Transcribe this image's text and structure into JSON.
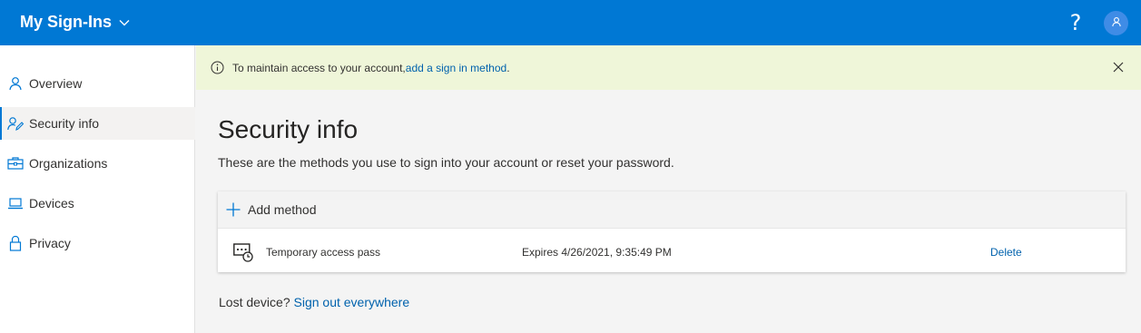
{
  "header": {
    "app_title": "My Sign-Ins",
    "help_label": "?",
    "colors": {
      "bar": "#0078d4",
      "avatar": "#3f8ce6"
    }
  },
  "sidebar": {
    "items": [
      {
        "label": "Overview",
        "icon": "person-icon",
        "active": false
      },
      {
        "label": "Security info",
        "icon": "person-edit-icon",
        "active": true
      },
      {
        "label": "Organizations",
        "icon": "briefcase-icon",
        "active": false
      },
      {
        "label": "Devices",
        "icon": "laptop-icon",
        "active": false
      },
      {
        "label": "Privacy",
        "icon": "lock-icon",
        "active": false
      }
    ]
  },
  "banner": {
    "text": "To maintain access to your account, ",
    "link": "add a sign in method",
    "suffix": ".",
    "background": "#eff6d9"
  },
  "main": {
    "title": "Security info",
    "subtitle": "These are the methods you use to sign into your account or reset your password.",
    "add_method_label": "Add method",
    "methods": [
      {
        "name": "Temporary access pass",
        "detail": "Expires 4/26/2021, 9:35:49 PM",
        "action": "Delete",
        "icon": "temporary-pass-icon"
      }
    ],
    "lost_device_text": "Lost device? ",
    "sign_out_link": "Sign out everywhere"
  }
}
